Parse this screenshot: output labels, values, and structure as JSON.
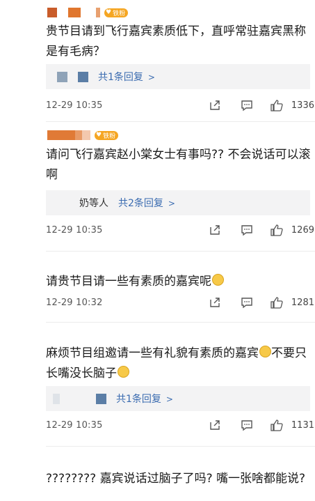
{
  "comments": [
    {
      "fan_badge": "铁粉",
      "text": "贵节目请到飞行嘉宾素质低下，直呼常驻嘉宾黑称是有毛病？",
      "replies": {
        "names": "",
        "link": "共1条回复"
      },
      "time": "12-29 10:35",
      "likes": "1336"
    },
    {
      "fan_badge": "铁粉",
      "text": "请问飞行嘉宾赵小棠女士有事吗?? 不会说话可以滚啊",
      "replies": {
        "names": "奶等人",
        "link": "共2条回复"
      },
      "time": "12-29 10:35",
      "likes": "1269"
    },
    {
      "text": "请贵节目请一些有素质的嘉宾呢",
      "time": "12-29 10:32",
      "likes": "1281"
    },
    {
      "text_1": "麻烦节目组邀请一些有礼貌有素质的嘉宾",
      "text_2": "不要只长嘴没长脑子",
      "replies": {
        "names": "",
        "link": "共1条回复"
      },
      "time": "12-29 10:35",
      "likes": "1131"
    },
    {
      "text": "???????? 嘉宾说话过脑子了吗? 嘴一张啥都能说?"
    }
  ],
  "icons": {
    "share": "share-icon",
    "comment": "comment-icon",
    "like": "like-icon",
    "chevron": "chevron-right-icon",
    "emoji": "smile-emoji-icon",
    "fan": "heart-badge-icon"
  },
  "colors": {
    "link": "#3a6bb0",
    "badge": "#f5a623",
    "reply_bg": "#f3f3f4"
  }
}
